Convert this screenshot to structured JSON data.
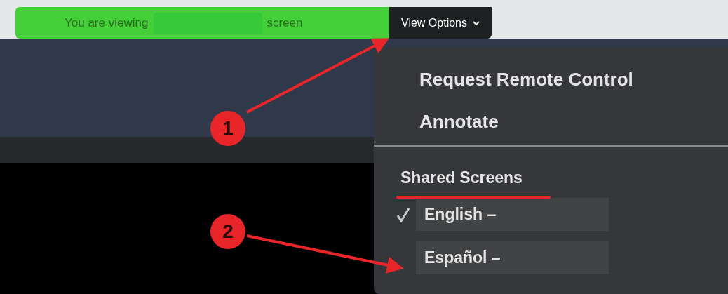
{
  "banner": {
    "text_before": "You are viewing",
    "text_after": "screen"
  },
  "view_options_button": {
    "label": "View Options"
  },
  "menu": {
    "items": [
      {
        "label": "Request Remote Control"
      },
      {
        "label": "Annotate"
      }
    ],
    "section_title": "Shared Screens",
    "screens": [
      {
        "label": "English –",
        "checked": true
      },
      {
        "label": "Español –",
        "checked": false
      }
    ]
  },
  "annotations": [
    {
      "label": "1"
    },
    {
      "label": "2"
    }
  ]
}
